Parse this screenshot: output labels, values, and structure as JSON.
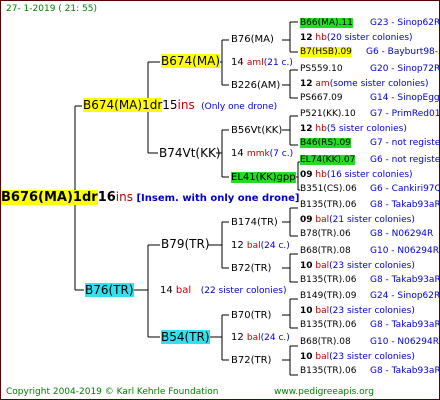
{
  "header": {
    "counter": "27-   1-2019  (  21:  55)"
  },
  "footer": {
    "copyright": "Copyright 2004-2019 © Karl Kehrle Foundation",
    "site": "www.pedigreeapis.org"
  },
  "root": {
    "name": "B676(MA)1dr",
    "num": "16",
    "unit": "ins",
    "note": "[Insem. with only one drone]"
  },
  "gen1": {
    "top": {
      "name": "B674(MA)1dr",
      "num": "15",
      "unit": "ins",
      "note": "(Only one drone)"
    },
    "bottom": {
      "name": "B76(TR)",
      "num": "14",
      "unit": "bal",
      "note": "(22 sister colonies)"
    }
  },
  "gen2": {
    "a": {
      "name": "B674(MA)",
      "num": "14",
      "unit": "aml",
      "note": "(21 c.)"
    },
    "b": {
      "name": "B74Vt(KK)",
      "num": "14",
      "unit": "mmk",
      "note": "(7 c.)"
    },
    "c": {
      "name": "B79(TR)",
      "num": "12",
      "unit": "bal",
      "note": "(24 c.)"
    },
    "d": {
      "name": "B54(TR)",
      "num": "12",
      "unit": "bal",
      "note": "(24 c.)"
    }
  },
  "gen3": {
    "a_top": "B76(MA)",
    "a_bot": "B226(AM)",
    "b_top": "B56Vt(KK)",
    "b_bot": "EL41(KK)gpp",
    "c_top": "B174(TR)",
    "c_bot": "B72(TR)",
    "d_top": "B70(TR)",
    "d_bot": "B72(TR)"
  },
  "gen4": [
    {
      "name": "B66(MA).11",
      "tail": "G23 - Sinop62R",
      "num": "12",
      "unit": "hb",
      "note": "(20 sister colonies)",
      "hl": "green"
    },
    {
      "name": "B7(HSB).09",
      "tail": "G6 - Bayburt98-3",
      "hl": "yellow"
    },
    {
      "name": "PS559.10",
      "tail": "G20 - Sinop72R",
      "num": "12",
      "unit": "am",
      "note": "(some sister colonies)"
    },
    {
      "name": "PS667.09",
      "tail": "G14 - SinopEgg86R"
    },
    {
      "name": "P521(KK).10",
      "tail": "G7 - PrimRed01",
      "num": "12",
      "unit": "hb",
      "note": "(5 sister colonies)"
    },
    {
      "name": "B46(RS).09",
      "tail": "G7 - not registe",
      "hl": "green"
    },
    {
      "name": "EL74(KK).07",
      "tail": "G6 - not registe",
      "num": "09",
      "unit": "hb",
      "note": "(16 sister colonies)",
      "hl": "green"
    },
    {
      "name": "B351(CS).06",
      "tail": "G6 - Cankiri97Q"
    },
    {
      "name": "B135(TR).06",
      "tail": "G8 - Takab93aR",
      "num": "09",
      "unit": "bal",
      "note": "(21 sister colonies)"
    },
    {
      "name": "B78(TR).06",
      "tail": "G8 - N06294R"
    },
    {
      "name": "B68(TR).08",
      "tail": "G10 - N06294R",
      "num": "10",
      "unit": "bal",
      "note": "(23 sister colonies)"
    },
    {
      "name": "B135(TR).06",
      "tail": "G8 - Takab93aR"
    },
    {
      "name": "B149(TR).09",
      "tail": "G24 - Sinop62R",
      "num": "10",
      "unit": "bal",
      "note": "(23 sister colonies)"
    },
    {
      "name": "B135(TR).06",
      "tail": "G8 - Takab93aR"
    },
    {
      "name": "B68(TR).08",
      "tail": "G10 - N06294R",
      "num": "10",
      "unit": "bal",
      "note": "(23 sister colonies)"
    },
    {
      "name": "B135(TR).06",
      "tail": "G8 - Takab93aR"
    }
  ],
  "colors": {
    "frame": "#5a0000",
    "yellow": "#ffff00",
    "cyan": "#33e0f0",
    "green": "#22dd22",
    "red": "#c00000",
    "blue": "#0000cc"
  }
}
